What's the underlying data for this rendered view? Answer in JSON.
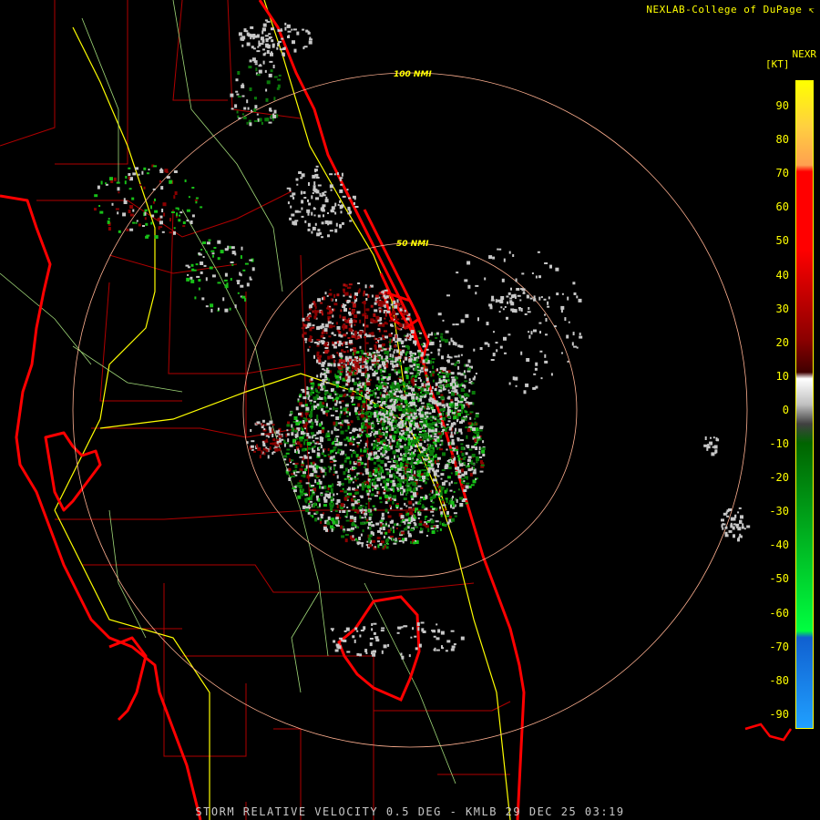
{
  "credit": "NEXLAB-College of DuPage",
  "product": "NEXR",
  "unit": "[KT]",
  "range_rings": [
    "100 NMI",
    "50 NMI"
  ],
  "footer": "STORM RELATIVE VELOCITY 0.5 DEG - KMLB 29 DEC 25 03:19",
  "legend": {
    "ticks": [
      "90",
      "80",
      "70",
      "60",
      "50",
      "40",
      "30",
      "20",
      "10",
      "0",
      "-10",
      "-20",
      "-30",
      "-40",
      "-50",
      "-60",
      "-70",
      "-80",
      "-90"
    ],
    "colors": {
      "top": "#ffff00",
      "orange": "#ffa050",
      "red": "#ff0000",
      "dark_red": "#8b0000",
      "gray": "#c0c0c0",
      "dark_green": "#006400",
      "green": "#00ff40",
      "blue": "#1060d0",
      "light_blue": "#20a0ff"
    }
  },
  "map_colors": {
    "coast": "#ff0000",
    "counties": "#b00000",
    "roads_major": "#ffff00",
    "roads_minor": "#b0e080",
    "rings": "#ffb090"
  }
}
